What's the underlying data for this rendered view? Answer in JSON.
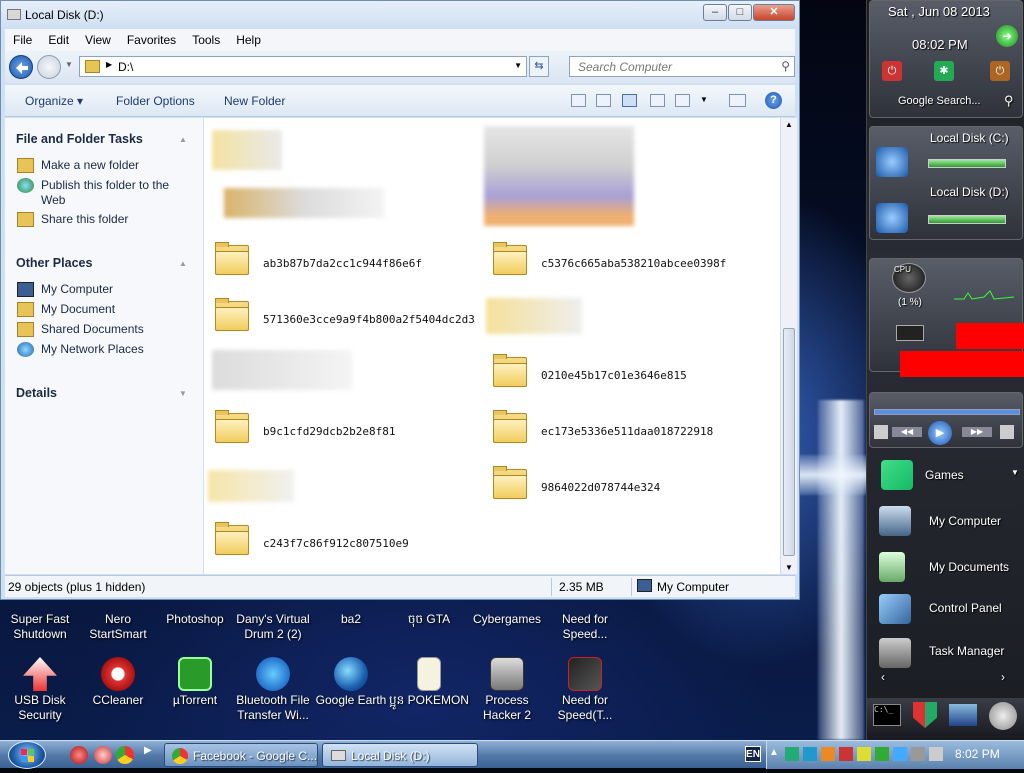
{
  "window": {
    "title": "Local Disk (D:)",
    "menu": [
      "File",
      "Edit",
      "View",
      "Favorites",
      "Tools",
      "Help"
    ],
    "address": "D:\\",
    "search_placeholder": "Search Computer",
    "commands": {
      "organize": "Organize",
      "folder_options": "Folder Options",
      "new_folder": "New Folder"
    },
    "tasks_section": "File and Folder Tasks",
    "tasks": [
      "Make a new folder",
      "Publish this folder to the Web",
      "Share this folder"
    ],
    "places_section": "Other Places",
    "places": [
      "My Computer",
      "My Document",
      "Shared Documents",
      "My Network Places"
    ],
    "details_section": "Details",
    "folders_left": [
      "ab3b87b7da2cc1c944f86e6f",
      "571360e3cce9a9f4b800a2f5404dc2d3",
      "b9c1cfd29dcb2b2e8f81",
      "c243f7c86f912c807510e9"
    ],
    "folders_right": [
      "c5376c665aba538210abcee0398f",
      "0210e45b17c01e3646e815",
      "ec173e5336e511daa018722918",
      "9864022d078744e324"
    ],
    "status": {
      "objects": "29 objects (plus 1 hidden)",
      "size": "2.35 MB",
      "zone": "My Computer"
    }
  },
  "desktop_icons": {
    "row1": [
      "Super Fast Shutdown",
      "Nero StartSmart",
      "Photoshop",
      "Dany's Virtual Drum 2 (2)",
      "ba2",
      "ចុច GTA",
      "Cybergames",
      "Need for Speed..."
    ],
    "row2": [
      "USB Disk Security",
      "CCleaner",
      "µTorrent",
      "Bluetooth File Transfer Wi...",
      "Google Earth",
      "ប្អូន POKEMON",
      "Process Hacker 2",
      "Need for Speed(T..."
    ]
  },
  "sidebar": {
    "date": "Sat , Jun 08 2013",
    "time": "08:02 PM",
    "google_search": "Google Search...",
    "drive_c": "Local Disk (C:)",
    "drive_d": "Local Disk (D:)",
    "cpu_label": "CPU",
    "cpu_percent": "(1 %)",
    "launcher": [
      "Games",
      "My Computer",
      "My Documents",
      "Control Panel",
      "Task Manager"
    ]
  },
  "taskbar": {
    "buttons": [
      "Facebook - Google C...",
      "Local Disk (D:)"
    ],
    "lang": "EN",
    "clock": "8:02 PM"
  },
  "colors": {
    "window_bg": "#cfe0f3",
    "taskbar": "#5178a6",
    "accent_red": "#ff0000",
    "bar_green": "#2e9b30"
  }
}
